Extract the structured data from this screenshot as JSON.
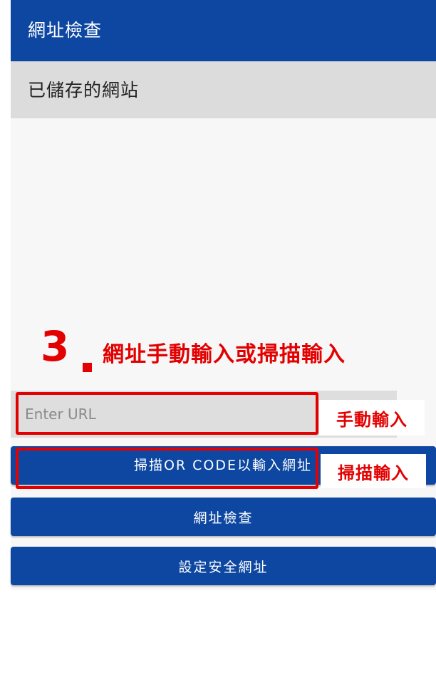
{
  "app_bar": {
    "title": "網址檢查"
  },
  "saved_section": {
    "title": "已儲存的網站"
  },
  "url_input": {
    "placeholder": "Enter URL",
    "value": ""
  },
  "buttons": {
    "scan": "掃描OR CODE以輸入網址",
    "check": "網址檢查",
    "set_safe": "設定安全網址"
  },
  "annotations": {
    "step_number": "3",
    "step_text": "網址手動輸入或掃描輸入",
    "manual_tag": "手動輸入",
    "scan_tag": "掃描輸入",
    "color": "#e30000"
  },
  "colors": {
    "primary": "#0d47a1",
    "section_bg": "#dcdcdc",
    "input_bg": "#dedede"
  }
}
